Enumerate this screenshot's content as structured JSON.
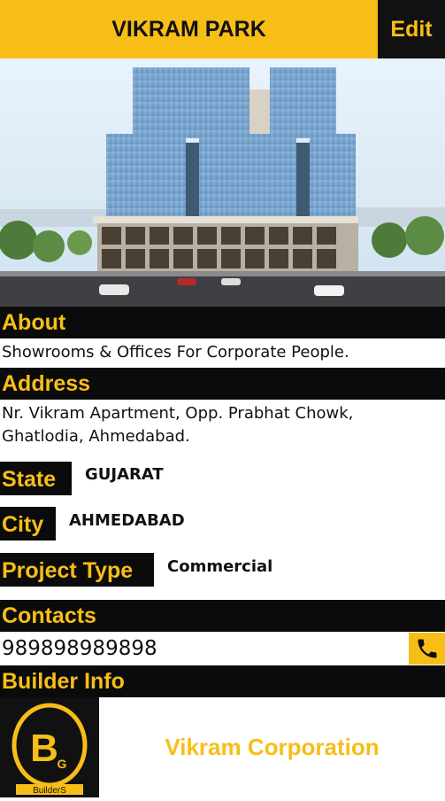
{
  "header": {
    "title": "VIKRAM PARK",
    "edit_label": "Edit"
  },
  "hero": {
    "image": "building-photo"
  },
  "about": {
    "heading": "About",
    "text": "Showrooms & Offices For Corporate People."
  },
  "address": {
    "heading": "Address",
    "line1": "Nr. Vikram Apartment, Opp. Prabhat Chowk,",
    "line2": "Ghatlodia, Ahmedabad."
  },
  "state": {
    "label": "State",
    "value": "GUJARAT"
  },
  "city": {
    "label": "City",
    "value": "AHMEDABAD"
  },
  "project_type": {
    "label": "Project Type",
    "value": "Commercial"
  },
  "contacts": {
    "heading": "Contacts",
    "phone": "989898989898",
    "phone_icon": "phone-icon"
  },
  "builder": {
    "heading": "Builder Info",
    "name": "Vikram Corporation",
    "logo_letters": "B G",
    "logo_caption": "BuilderS"
  },
  "colors": {
    "accent": "#f7be17",
    "dark": "#0b0b0b"
  }
}
